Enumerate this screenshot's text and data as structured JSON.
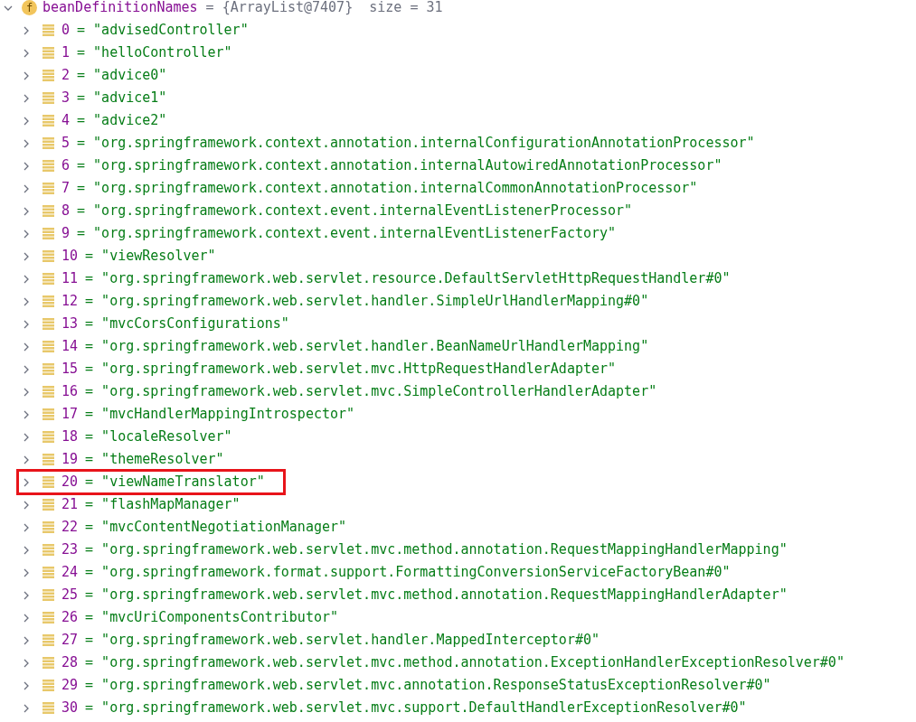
{
  "root": {
    "expanded": true,
    "badge": "f",
    "name": "beanDefinitionNames",
    "value": "= {ArrayList@7407}  size = 31"
  },
  "items": [
    {
      "index": "0",
      "value": "= \"advisedController\"",
      "expanded": false,
      "highlighted": false
    },
    {
      "index": "1",
      "value": "= \"helloController\"",
      "expanded": false,
      "highlighted": false
    },
    {
      "index": "2",
      "value": "= \"advice0\"",
      "expanded": false,
      "highlighted": false
    },
    {
      "index": "3",
      "value": "= \"advice1\"",
      "expanded": false,
      "highlighted": false
    },
    {
      "index": "4",
      "value": "= \"advice2\"",
      "expanded": false,
      "highlighted": false
    },
    {
      "index": "5",
      "value": "= \"org.springframework.context.annotation.internalConfigurationAnnotationProcessor\"",
      "expanded": false,
      "highlighted": false
    },
    {
      "index": "6",
      "value": "= \"org.springframework.context.annotation.internalAutowiredAnnotationProcessor\"",
      "expanded": false,
      "highlighted": false
    },
    {
      "index": "7",
      "value": "= \"org.springframework.context.annotation.internalCommonAnnotationProcessor\"",
      "expanded": false,
      "highlighted": false
    },
    {
      "index": "8",
      "value": "= \"org.springframework.context.event.internalEventListenerProcessor\"",
      "expanded": false,
      "highlighted": false
    },
    {
      "index": "9",
      "value": "= \"org.springframework.context.event.internalEventListenerFactory\"",
      "expanded": false,
      "highlighted": false
    },
    {
      "index": "10",
      "value": "= \"viewResolver\"",
      "expanded": false,
      "highlighted": false
    },
    {
      "index": "11",
      "value": "= \"org.springframework.web.servlet.resource.DefaultServletHttpRequestHandler#0\"",
      "expanded": false,
      "highlighted": false
    },
    {
      "index": "12",
      "value": "= \"org.springframework.web.servlet.handler.SimpleUrlHandlerMapping#0\"",
      "expanded": false,
      "highlighted": false
    },
    {
      "index": "13",
      "value": "= \"mvcCorsConfigurations\"",
      "expanded": false,
      "highlighted": false
    },
    {
      "index": "14",
      "value": "= \"org.springframework.web.servlet.handler.BeanNameUrlHandlerMapping\"",
      "expanded": false,
      "highlighted": false
    },
    {
      "index": "15",
      "value": "= \"org.springframework.web.servlet.mvc.HttpRequestHandlerAdapter\"",
      "expanded": false,
      "highlighted": false
    },
    {
      "index": "16",
      "value": "= \"org.springframework.web.servlet.mvc.SimpleControllerHandlerAdapter\"",
      "expanded": false,
      "highlighted": false
    },
    {
      "index": "17",
      "value": "= \"mvcHandlerMappingIntrospector\"",
      "expanded": false,
      "highlighted": false
    },
    {
      "index": "18",
      "value": "= \"localeResolver\"",
      "expanded": false,
      "highlighted": false
    },
    {
      "index": "19",
      "value": "= \"themeResolver\"",
      "expanded": false,
      "highlighted": false
    },
    {
      "index": "20",
      "value": "= \"viewNameTranslator\"",
      "expanded": false,
      "highlighted": true
    },
    {
      "index": "21",
      "value": "= \"flashMapManager\"",
      "expanded": false,
      "highlighted": false
    },
    {
      "index": "22",
      "value": "= \"mvcContentNegotiationManager\"",
      "expanded": false,
      "highlighted": false
    },
    {
      "index": "23",
      "value": "= \"org.springframework.web.servlet.mvc.method.annotation.RequestMappingHandlerMapping\"",
      "expanded": false,
      "highlighted": false
    },
    {
      "index": "24",
      "value": "= \"org.springframework.format.support.FormattingConversionServiceFactoryBean#0\"",
      "expanded": false,
      "highlighted": false
    },
    {
      "index": "25",
      "value": "= \"org.springframework.web.servlet.mvc.method.annotation.RequestMappingHandlerAdapter\"",
      "expanded": false,
      "highlighted": false
    },
    {
      "index": "26",
      "value": "= \"mvcUriComponentsContributor\"",
      "expanded": false,
      "highlighted": false
    },
    {
      "index": "27",
      "value": "= \"org.springframework.web.servlet.handler.MappedInterceptor#0\"",
      "expanded": false,
      "highlighted": false
    },
    {
      "index": "28",
      "value": "= \"org.springframework.web.servlet.mvc.method.annotation.ExceptionHandlerExceptionResolver#0\"",
      "expanded": false,
      "highlighted": false
    },
    {
      "index": "29",
      "value": "= \"org.springframework.web.servlet.mvc.annotation.ResponseStatusExceptionResolver#0\"",
      "expanded": false,
      "highlighted": false
    },
    {
      "index": "30",
      "value": "= \"org.springframework.web.servlet.mvc.support.DefaultHandlerExceptionResolver#0\"",
      "expanded": false,
      "highlighted": false
    }
  ]
}
